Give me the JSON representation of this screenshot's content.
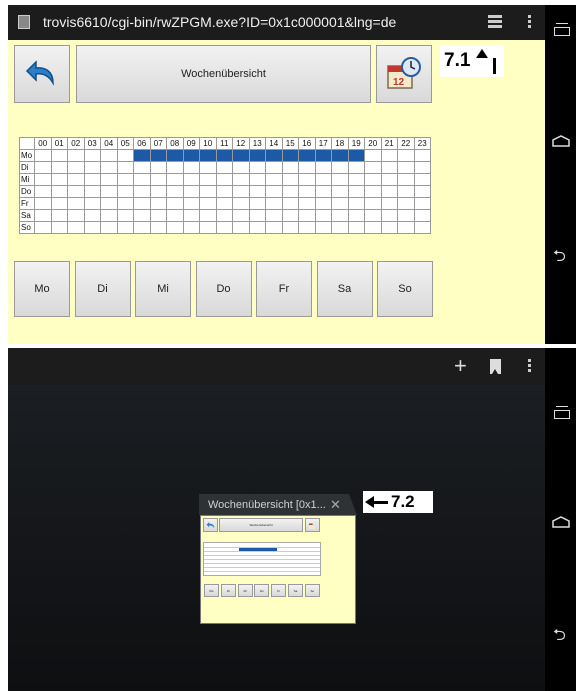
{
  "shot1": {
    "url": "trovis6610/cgi-bin/rwZPGM.exe?ID=0x1c000001&lng=de",
    "title_button": "Wochenübersicht",
    "annotation": "7.1",
    "calendar_icon_number": "12",
    "hours": [
      "00",
      "01",
      "02",
      "03",
      "04",
      "05",
      "06",
      "07",
      "08",
      "09",
      "10",
      "11",
      "12",
      "13",
      "14",
      "15",
      "16",
      "17",
      "18",
      "19",
      "20",
      "21",
      "22",
      "23"
    ],
    "days": [
      "Mo",
      "Di",
      "Mi",
      "Do",
      "Fr",
      "Sa",
      "So"
    ],
    "schedule": [
      {
        "day": "Mo",
        "active_hours": [
          "06",
          "07",
          "08",
          "09",
          "10",
          "11",
          "12",
          "13",
          "14",
          "15",
          "16",
          "17",
          "18",
          "19"
        ]
      }
    ],
    "day_buttons": [
      "Mo",
      "Di",
      "Mi",
      "Do",
      "Fr",
      "Sa",
      "So"
    ],
    "colors": {
      "page_bg": "#ffffc4",
      "active_cell": "#1d5aa6"
    }
  },
  "shot2": {
    "tab_title": "Wochenübersicht [0x1...",
    "close_glyph": "✕",
    "annotation": "7.2",
    "plus_glyph": "+"
  },
  "icons": {
    "favicon": "page-icon",
    "tabs": "tab-switcher-icon",
    "menu": "overflow-menu-icon",
    "back": "undo-arrow-icon",
    "calendar": "calendar-clock-icon",
    "new_tab": "plus-icon",
    "bookmark": "bookmark-icon",
    "close": "close-icon"
  }
}
